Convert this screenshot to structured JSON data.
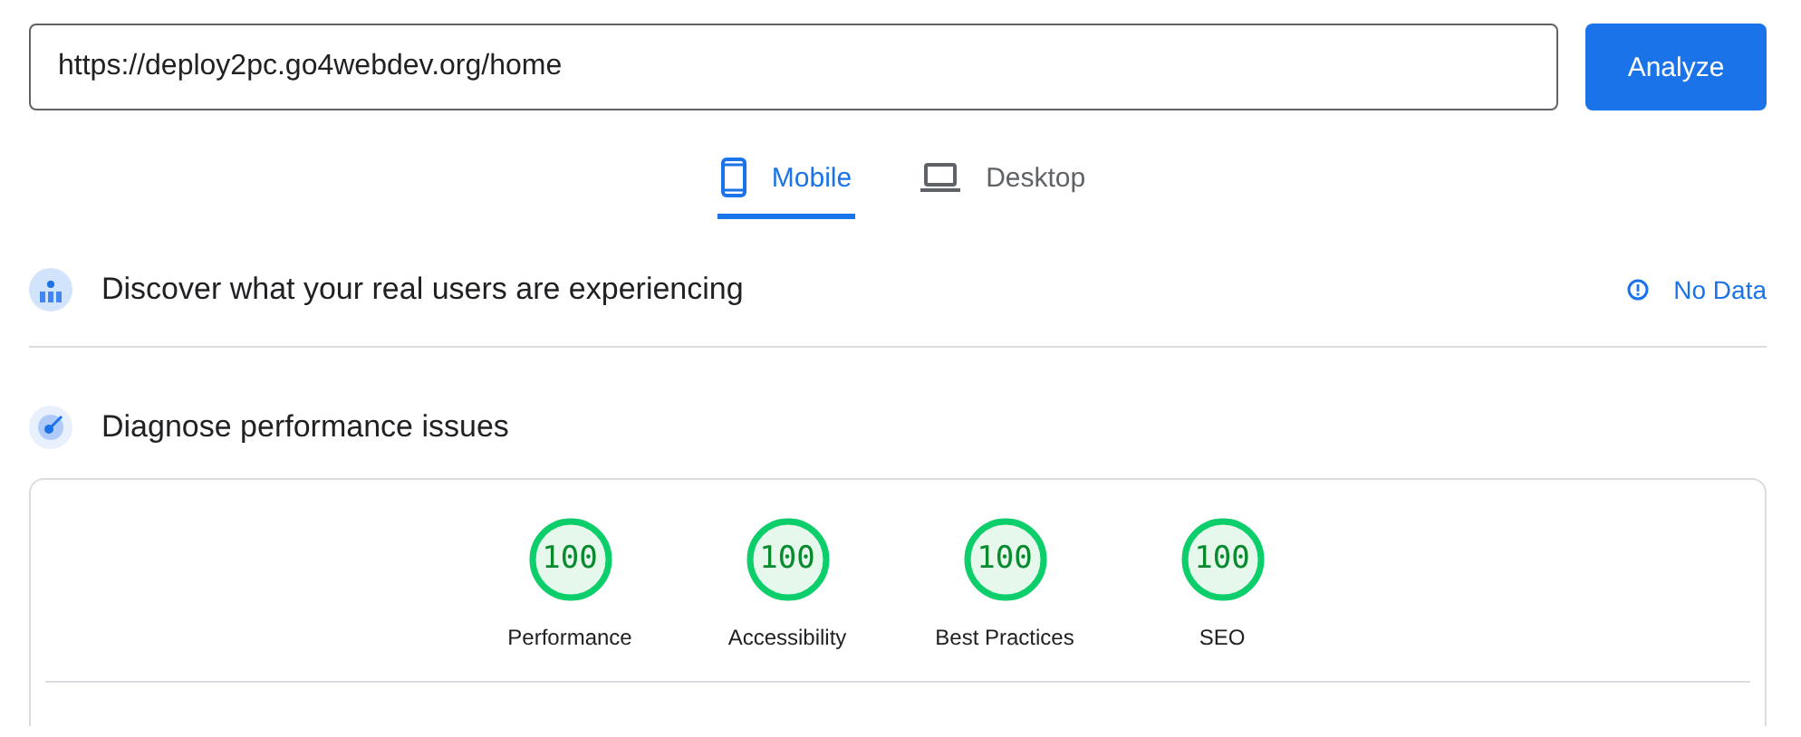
{
  "url_field": {
    "value": "https://deploy2pc.go4webdev.org/home"
  },
  "analyze_button": "Analyze",
  "tabs": [
    {
      "label": "Mobile",
      "kind": "phone",
      "selected": true
    },
    {
      "label": "Desktop",
      "kind": "laptop",
      "selected": false
    }
  ],
  "sections": [
    {
      "kind": "field",
      "title": "Discover what your real users are experiencing",
      "status": "No Data"
    },
    {
      "kind": "lab",
      "title": "Diagnose performance issues"
    }
  ],
  "scores": [
    {
      "score": "100",
      "label": "Performance",
      "level": 1
    },
    {
      "score": "100",
      "label": "Accessibility",
      "level": 1
    },
    {
      "score": "100",
      "label": "Best Practices",
      "level": 1
    },
    {
      "score": "100",
      "label": "SEO",
      "level": 1
    }
  ]
}
